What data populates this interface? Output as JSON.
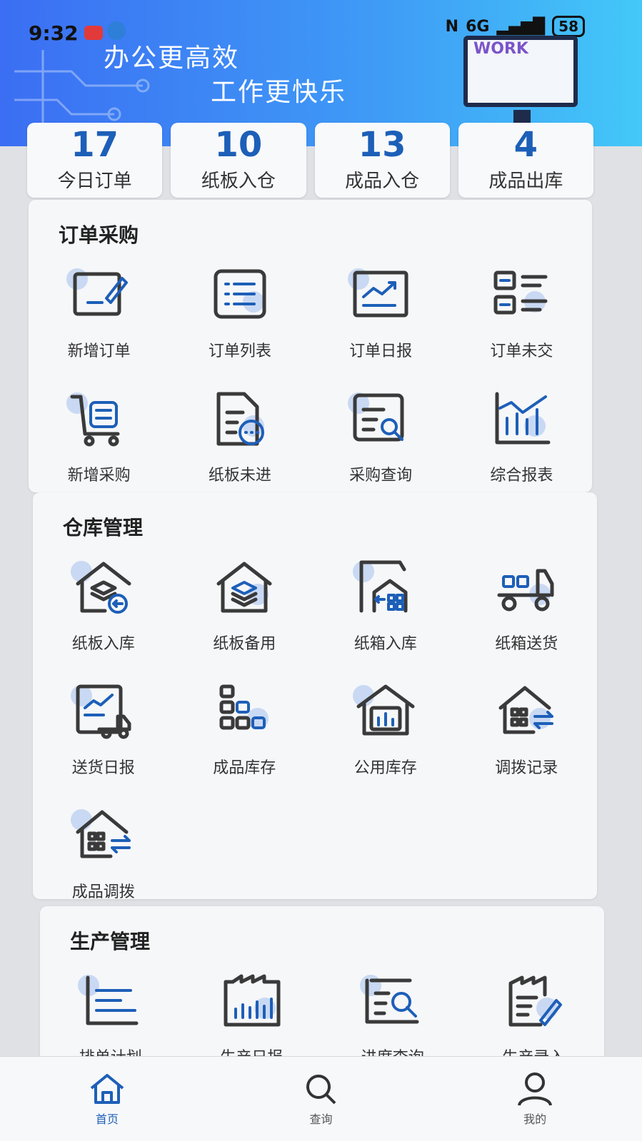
{
  "status_bar": {
    "time": "9:32",
    "battery": "58",
    "signal_text": "6G"
  },
  "banner": {
    "line1": "办公更高效",
    "line2": "工作更快乐",
    "illustration_text": "WORK"
  },
  "stats": [
    {
      "value": "17",
      "label": "今日订单"
    },
    {
      "value": "10",
      "label": "纸板入仓"
    },
    {
      "value": "13",
      "label": "成品入仓"
    },
    {
      "value": "4",
      "label": "成品出库"
    }
  ],
  "sections": {
    "order": {
      "title": "订单采购",
      "items": [
        {
          "label": "新增订单",
          "icon": "edit-document-icon"
        },
        {
          "label": "订单列表",
          "icon": "list-icon"
        },
        {
          "label": "订单日报",
          "icon": "trend-chart-icon"
        },
        {
          "label": "订单未交",
          "icon": "card-list-icon"
        },
        {
          "label": "新增采购",
          "icon": "cart-icon"
        },
        {
          "label": "纸板未进",
          "icon": "document-pending-icon"
        },
        {
          "label": "采购查询",
          "icon": "search-report-icon"
        },
        {
          "label": "综合报表",
          "icon": "bar-chart-icon"
        }
      ]
    },
    "warehouse": {
      "title": "仓库管理",
      "items": [
        {
          "label": "纸板入库",
          "icon": "warehouse-in-icon"
        },
        {
          "label": "纸板备用",
          "icon": "warehouse-stack-icon"
        },
        {
          "label": "纸箱入库",
          "icon": "box-in-icon"
        },
        {
          "label": "纸箱送货",
          "icon": "truck-icon"
        },
        {
          "label": "送货日报",
          "icon": "delivery-report-icon"
        },
        {
          "label": "成品库存",
          "icon": "blocks-icon"
        },
        {
          "label": "公用库存",
          "icon": "warehouse-chart-icon"
        },
        {
          "label": "调拨记录",
          "icon": "transfer-house-icon"
        },
        {
          "label": "成品调拨",
          "icon": "transfer-house-icon"
        }
      ]
    },
    "production": {
      "title": "生产管理",
      "items": [
        {
          "label": "排单计划",
          "icon": "plan-bars-icon"
        },
        {
          "label": "生产日报",
          "icon": "factory-chart-icon"
        },
        {
          "label": "进度查询",
          "icon": "progress-search-icon"
        },
        {
          "label": "生产录入",
          "icon": "factory-edit-icon"
        }
      ]
    }
  },
  "tabbar": [
    {
      "label": "首页",
      "icon": "home-icon",
      "active": true
    },
    {
      "label": "查询",
      "icon": "search-icon",
      "active": false
    },
    {
      "label": "我的",
      "icon": "user-icon",
      "active": false
    }
  ],
  "colors": {
    "accent": "#1d5fb8",
    "icon_dark": "#3a3a3a",
    "icon_light": "#c9d9f3"
  }
}
